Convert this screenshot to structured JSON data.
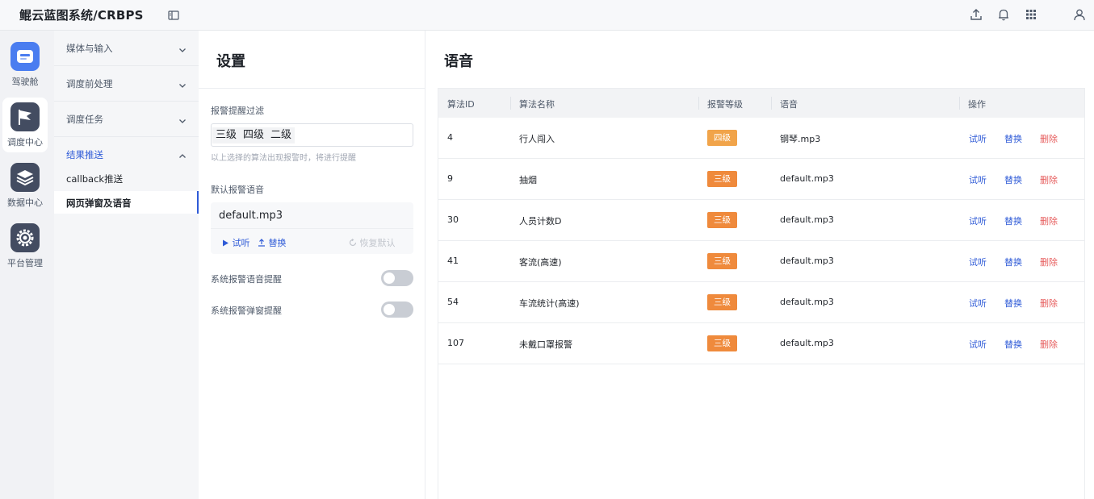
{
  "header": {
    "title": "鲲云蓝图系统/CRBPS",
    "icons": [
      "sidebar-toggle-icon",
      "upload-icon",
      "bell-icon",
      "apps-grid-icon",
      "user-icon"
    ]
  },
  "rail": {
    "items": [
      {
        "label": "驾驶舱",
        "icon": "cockpit-icon",
        "active": false
      },
      {
        "label": "调度中心",
        "icon": "flag-icon",
        "active": true
      },
      {
        "label": "数据中心",
        "icon": "layers-icon",
        "active": false
      },
      {
        "label": "平台管理",
        "icon": "gear-icon",
        "active": false
      }
    ]
  },
  "menu": {
    "groups": [
      {
        "label": "媒体与输入"
      },
      {
        "label": "调度前处理"
      },
      {
        "label": "调度任务"
      },
      {
        "label": "结果推送"
      }
    ],
    "sub_items": [
      {
        "label": "callback推送"
      },
      {
        "label": "网页弹窗及语音"
      }
    ]
  },
  "settings": {
    "title": "设置",
    "filter_label": "报警提醒过滤",
    "filter_tags": [
      "三级",
      "四级",
      "二级"
    ],
    "filter_hint": "以上选择的算法出现报警时，将进行提醒",
    "default_voice_label": "默认报警语音",
    "default_voice_file": "default.mp3",
    "listen_label": "试听",
    "replace_label": "替换",
    "restore_label": "恢复默认",
    "voice_toggle_label": "系统报警语音提醒",
    "voice_toggle_on": false,
    "popup_toggle_label": "系统报警弹窗提醒",
    "popup_toggle_on": false
  },
  "voice": {
    "title": "语音",
    "columns": [
      "算法ID",
      "算法名称",
      "报警等级",
      "语音",
      "操作"
    ],
    "rows": [
      {
        "id": "4",
        "name": "行人闯入",
        "level": "四级",
        "audio": "钢琴.mp3"
      },
      {
        "id": "9",
        "name": "抽烟",
        "level": "三级",
        "audio": "default.mp3"
      },
      {
        "id": "30",
        "name": "人员计数D",
        "level": "三级",
        "audio": "default.mp3"
      },
      {
        "id": "41",
        "name": "客流(高速)",
        "level": "三级",
        "audio": "default.mp3"
      },
      {
        "id": "54",
        "name": "车流统计(高速)",
        "level": "三级",
        "audio": "default.mp3"
      },
      {
        "id": "107",
        "name": "未戴口罩报警",
        "level": "三级",
        "audio": "default.mp3"
      }
    ],
    "actions": {
      "listen": "试听",
      "replace": "替换",
      "delete": "删除"
    }
  },
  "colors": {
    "accent": "#2f5bd7",
    "level_badge": "#ef8a3c",
    "danger": "#e65b5b"
  }
}
